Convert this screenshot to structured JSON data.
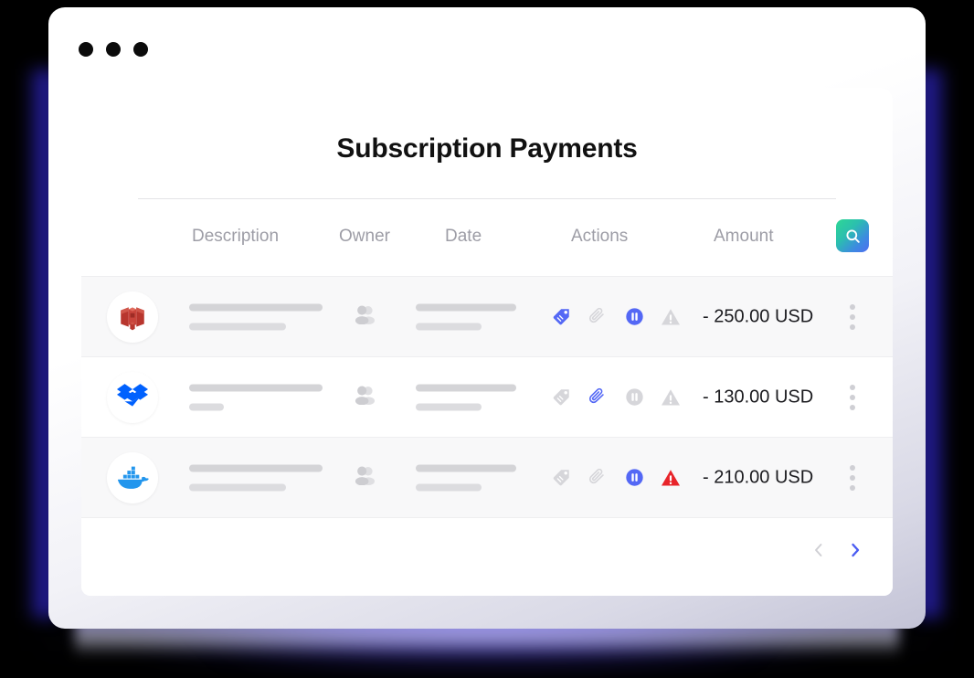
{
  "window": {
    "dots": [
      "close-dot",
      "minimize-dot",
      "maximize-dot"
    ]
  },
  "card": {
    "title": "Subscription Payments",
    "columns": [
      {
        "key": "description",
        "label": "Description"
      },
      {
        "key": "owner",
        "label": "Owner"
      },
      {
        "key": "date",
        "label": "Date"
      },
      {
        "key": "actions",
        "label": "Actions"
      },
      {
        "key": "amount",
        "label": "Amount"
      }
    ],
    "search": {
      "icon": "search-icon",
      "label": "Search"
    }
  },
  "rows": [
    {
      "logo": "aws-ec2-icon",
      "logo_color": "#c9453c",
      "shaded": true,
      "desc_bars": [
        146,
        106
      ],
      "date_bars": [
        110,
        72
      ],
      "owner_icon": "people-icon",
      "actions": [
        {
          "icon": "tag-icon",
          "state": "active",
          "color": "#5468f5"
        },
        {
          "icon": "paperclip-icon",
          "state": "muted",
          "color": "#d6d6da"
        },
        {
          "icon": "pause-icon",
          "state": "active",
          "color": "#5468f5"
        },
        {
          "icon": "warning-icon",
          "state": "muted",
          "color": "#d6d6da"
        }
      ],
      "amount": "- 250.00 USD",
      "menu": "row-menu-icon"
    },
    {
      "logo": "dropbox-icon",
      "logo_color": "#0061fe",
      "shaded": false,
      "desc_bars": [
        146,
        38
      ],
      "date_bars": [
        110,
        72
      ],
      "owner_icon": "people-icon",
      "actions": [
        {
          "icon": "tag-icon",
          "state": "muted",
          "color": "#d6d6da"
        },
        {
          "icon": "paperclip-icon",
          "state": "active",
          "color": "#5468f5"
        },
        {
          "icon": "pause-icon",
          "state": "muted",
          "color": "#d6d6da"
        },
        {
          "icon": "warning-icon",
          "state": "muted",
          "color": "#d6d6da"
        }
      ],
      "amount": "- 130.00 USD",
      "menu": "row-menu-icon"
    },
    {
      "logo": "docker-icon",
      "logo_color": "#2396ed",
      "shaded": true,
      "desc_bars": [
        146,
        106
      ],
      "date_bars": [
        110,
        72
      ],
      "owner_icon": "people-icon",
      "actions": [
        {
          "icon": "tag-icon",
          "state": "muted",
          "color": "#d6d6da"
        },
        {
          "icon": "paperclip-icon",
          "state": "muted",
          "color": "#d6d6da"
        },
        {
          "icon": "pause-icon",
          "state": "active",
          "color": "#5468f5"
        },
        {
          "icon": "warning-icon",
          "state": "alert",
          "color": "#e8242a"
        }
      ],
      "amount": "- 210.00 USD",
      "menu": "row-menu-icon"
    }
  ],
  "pagination": {
    "prev": {
      "icon": "chevron-left-icon",
      "state": "disabled",
      "color": "#cfcfd4"
    },
    "next": {
      "icon": "chevron-right-icon",
      "state": "enabled",
      "color": "#4a5cf2"
    }
  },
  "colors": {
    "accent_blue": "#5468f5",
    "alert_red": "#e8242a",
    "muted_gray": "#d6d6da",
    "header_text": "#9d9da6",
    "row_shade": "#f8f8f9",
    "glow_purple": "#5648dc"
  }
}
